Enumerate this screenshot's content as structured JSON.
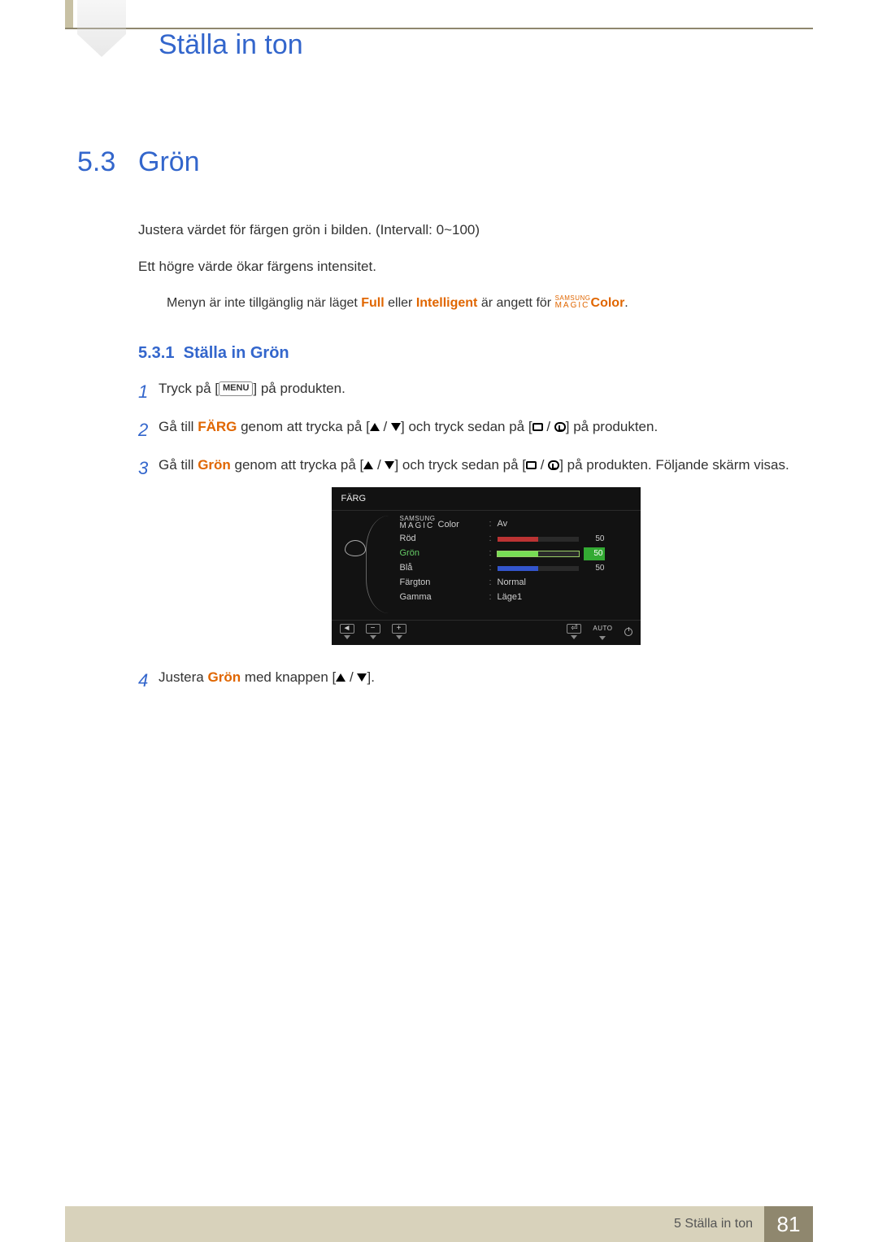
{
  "header": {
    "chapter_title": "Ställa in ton"
  },
  "section": {
    "number": "5.3",
    "title": "Grön"
  },
  "intro": {
    "p1": "Justera värdet för färgen grön i bilden. (Intervall: 0~100)",
    "p2": "Ett högre värde ökar färgens intensitet."
  },
  "note": {
    "prefix": "Menyn är inte tillgänglig när läget ",
    "full": "Full",
    "mid": " eller ",
    "intelligent": "Intelligent",
    "after": " är angett för ",
    "magic_samsung": "SAMSUNG",
    "magic_magic": "MAGIC",
    "color_label": "Color",
    "end": "."
  },
  "subsection": {
    "number": "5.3.1",
    "title": "Ställa in Grön"
  },
  "steps": {
    "s1_num": "1",
    "s1_a": "Tryck på [",
    "s1_menu": "MENU",
    "s1_b": "] på produkten.",
    "s2_num": "2",
    "s2_a": "Gå till ",
    "s2_farg": "FÄRG",
    "s2_b": " genom att trycka på [",
    "s2_c": "] och tryck sedan på [",
    "s2_d": "] på produkten.",
    "s3_num": "3",
    "s3_a": "Gå till ",
    "s3_gron": "Grön",
    "s3_b": " genom att trycka på [",
    "s3_c": "] och tryck sedan på [",
    "s3_d": "] på produkten. Följande skärm visas.",
    "s4_num": "4",
    "s4_a": "Justera ",
    "s4_gron": "Grön",
    "s4_b": " med knappen [",
    "s4_c": "]."
  },
  "osd": {
    "title": "FÄRG",
    "magic_samsung": "SAMSUNG",
    "magic_magic": "MAGIC",
    "magic_color": "Color",
    "av": "Av",
    "rod": "Röd",
    "gron": "Grön",
    "bla": "Blå",
    "fargton": "Färgton",
    "normal": "Normal",
    "gamma": "Gamma",
    "lage1": "Läge1",
    "val_rod": "50",
    "val_gron": "50",
    "val_bla": "50",
    "minus": "−",
    "plus": "+",
    "auto": "AUTO"
  },
  "footer": {
    "chapter": "5 Ställa in ton",
    "page": "81"
  }
}
